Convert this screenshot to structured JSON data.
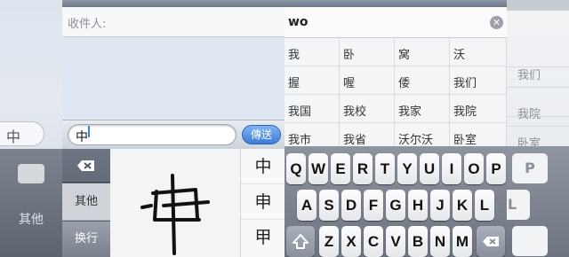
{
  "left_edge": {
    "field_char": "中",
    "other_label": "其他"
  },
  "right_edge": {
    "cells": [
      "",
      "我们",
      "",
      "我院",
      "卧室"
    ],
    "keys": [
      "P",
      "L",
      ""
    ]
  },
  "handwriting_screen": {
    "recipient_label": "收件人:",
    "input_value": "中",
    "send_label": "傳送",
    "side_keys": {
      "delete": "delete-icon",
      "other": "其他",
      "newline": "换行"
    },
    "candidates": [
      "中",
      "申",
      "甲"
    ],
    "stroke_color": "#111111"
  },
  "pinyin_screen": {
    "search_value": "wo",
    "clear_icon": "clear-icon",
    "candidates": [
      [
        "我",
        "卧",
        "窝",
        "沃"
      ],
      [
        "握",
        "喔",
        "倭",
        "我们"
      ],
      [
        "我国",
        "我校",
        "我家",
        "我院"
      ],
      [
        "我市",
        "我省",
        "沃尔沃",
        "卧室"
      ]
    ],
    "keyboard": {
      "row1": [
        "Q",
        "W",
        "E",
        "R",
        "T",
        "Y",
        "U",
        "I",
        "O",
        "P"
      ],
      "row2": [
        "A",
        "S",
        "D",
        "F",
        "G",
        "H",
        "J",
        "K",
        "L"
      ],
      "row3": [
        "Z",
        "X",
        "C",
        "V",
        "B",
        "N",
        "M"
      ],
      "shift_icon": "shift-icon",
      "delete_icon": "backspace-icon"
    }
  },
  "colors": {
    "send_button": "#3d7dd6",
    "caret": "#3a7fd9"
  }
}
